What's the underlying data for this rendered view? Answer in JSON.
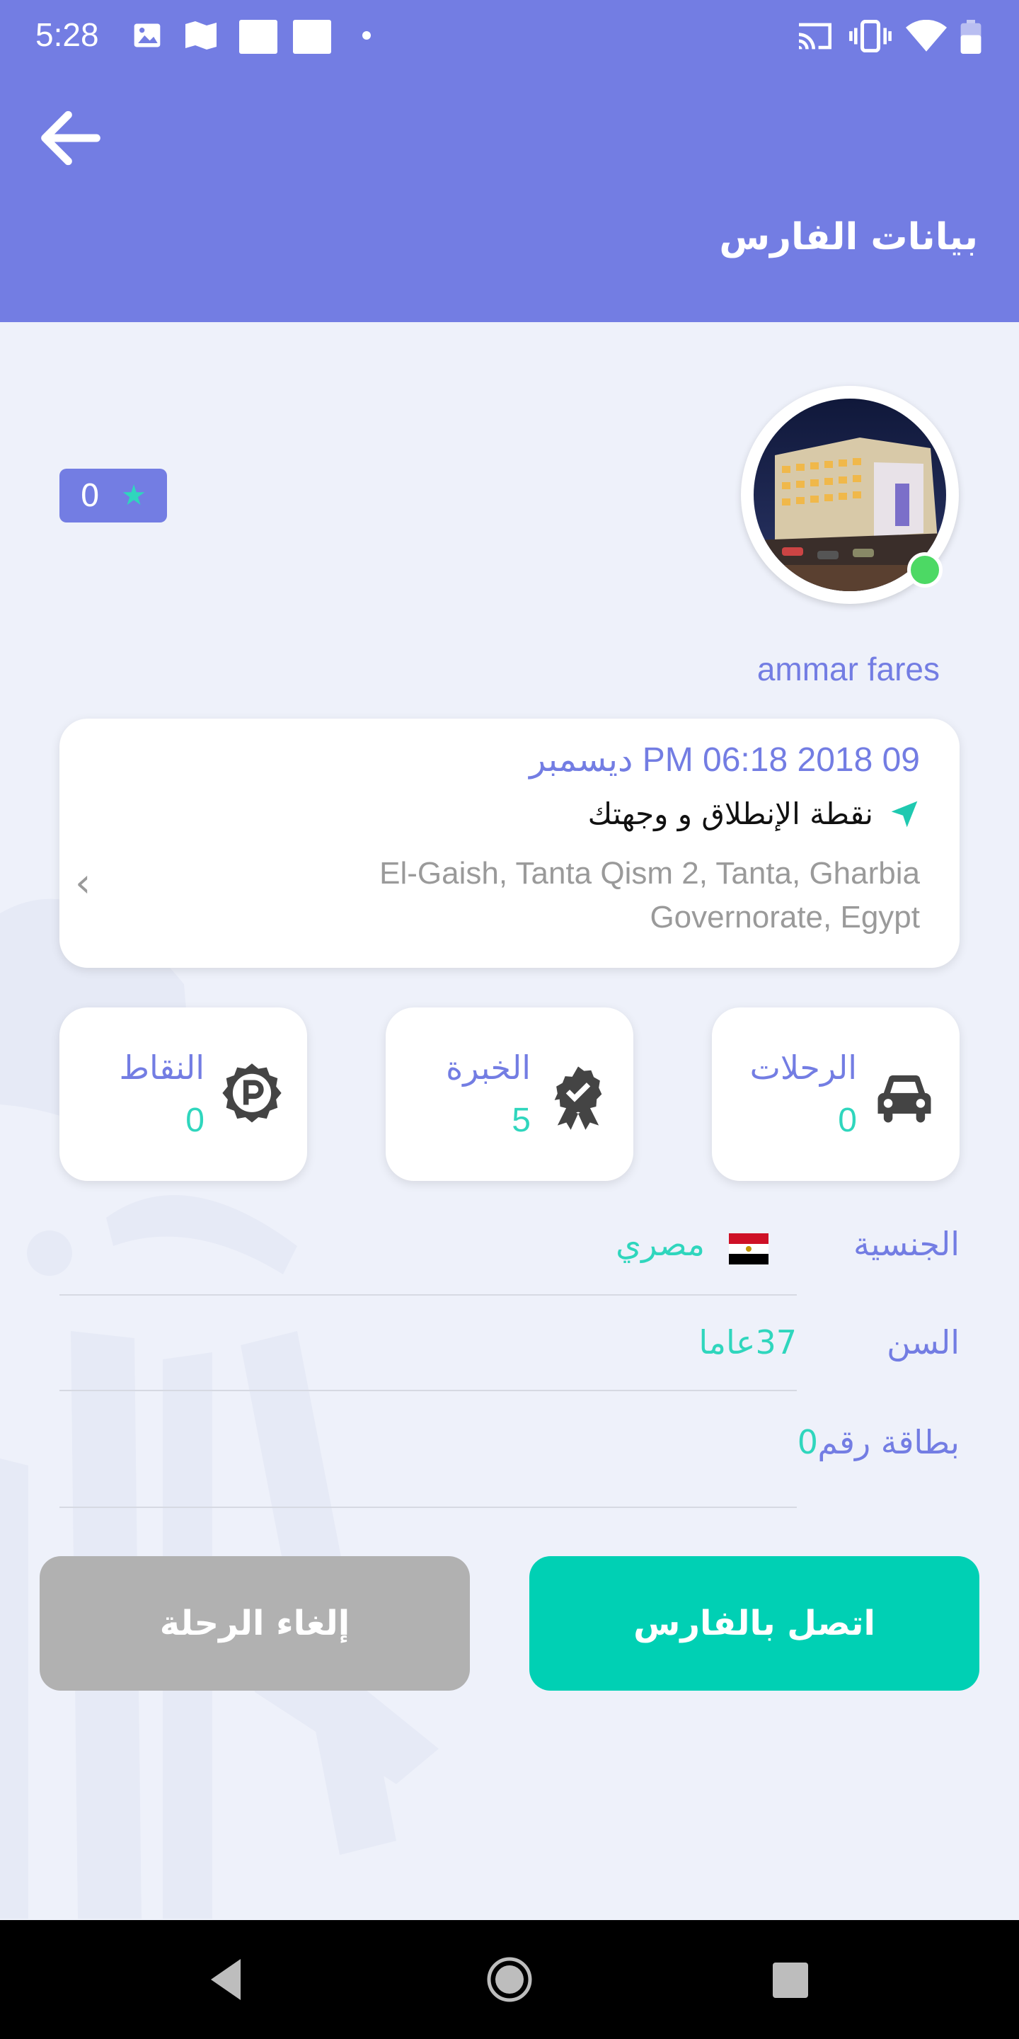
{
  "status_bar": {
    "time": "5:28"
  },
  "header": {
    "title": "بيانات الفارس"
  },
  "profile": {
    "rating": "0",
    "name": "ammar fares",
    "online_color": "#4cd964"
  },
  "trip_card": {
    "date": "PM 06:18 2018 09 ديسمبر",
    "location_label": "نقطة الإنطلاق و وجهتك",
    "address": "El-Gaish, Tanta Qism 2, Tanta, Gharbia Governorate, Egypt"
  },
  "stats": {
    "trips": {
      "label": "الرحلات",
      "value": "0",
      "icon": "car-icon"
    },
    "experience": {
      "label": "الخبرة",
      "value": "5",
      "icon": "award-badge-icon"
    },
    "points": {
      "label": "النقاط",
      "value": "0",
      "icon": "parking-badge-icon"
    }
  },
  "info": {
    "nationality_label": "الجنسية",
    "nationality_value": "مصري",
    "age_label": "السن",
    "age_value": "37عاما",
    "card_label": "بطاقة رقم",
    "card_value": "0"
  },
  "buttons": {
    "call": "اتصل بالفارس",
    "cancel": "إلغاء الرحلة"
  },
  "colors": {
    "primary": "#737de3",
    "accent": "#2fd6bd",
    "call_button": "#00d0b4",
    "cancel_button": "#b1b1b1"
  }
}
